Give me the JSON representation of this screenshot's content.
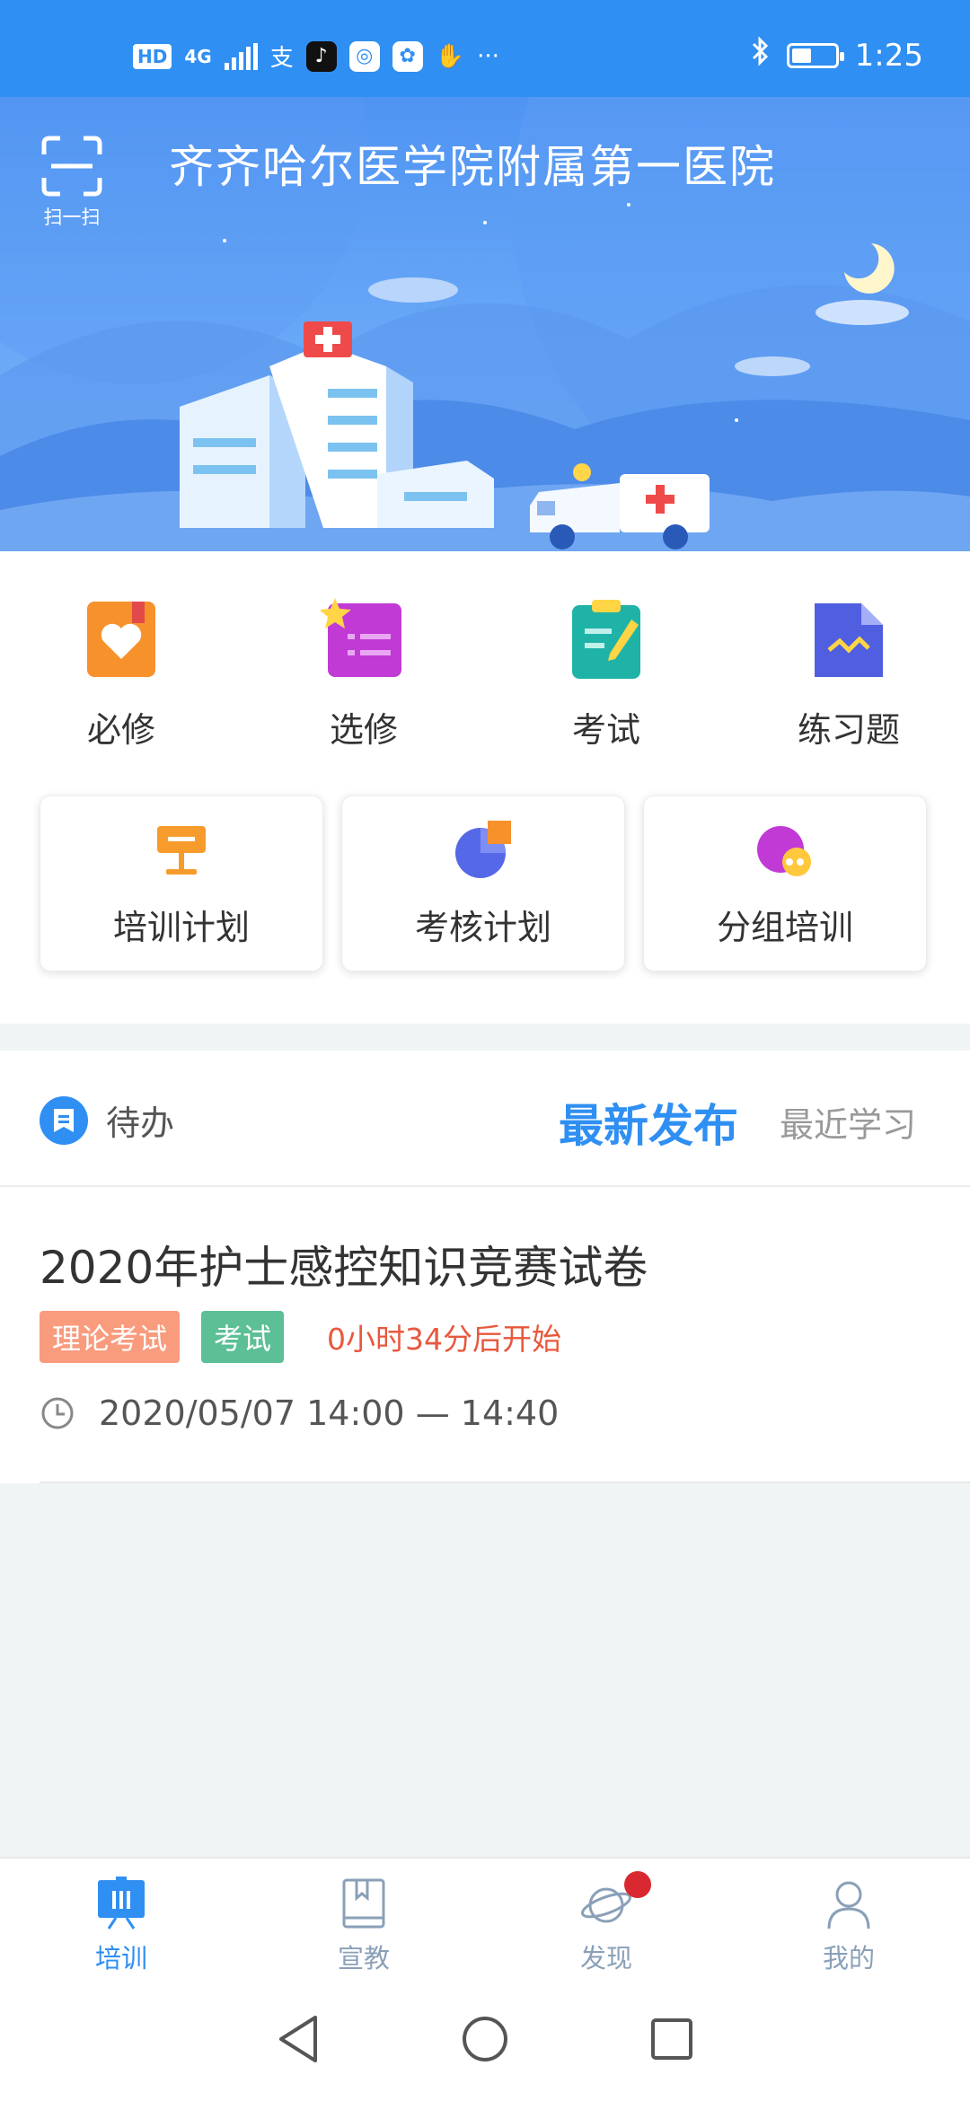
{
  "status_bar": {
    "network_badge": "HD",
    "network_type": "4G",
    "app_glyphs": [
      "支",
      "♪"
    ],
    "more": "···",
    "time": "1:25",
    "battery_level": 0.45
  },
  "header": {
    "scan_label": "扫一扫",
    "hospital_name": "齐齐哈尔医学院附属第一医院"
  },
  "quick_menu": [
    {
      "label": "必修",
      "icon": "heart-book-icon"
    },
    {
      "label": "选修",
      "icon": "star-list-icon"
    },
    {
      "label": "考试",
      "icon": "clipboard-pen-icon"
    },
    {
      "label": "练习题",
      "icon": "document-wave-icon"
    }
  ],
  "plan_cards": [
    {
      "label": "培训计划",
      "icon": "presentation-board-icon"
    },
    {
      "label": "考核计划",
      "icon": "pie-chart-icon"
    },
    {
      "label": "分组培训",
      "icon": "group-chat-icon"
    }
  ],
  "tabs": {
    "todo_label": "待办",
    "latest_label": "最新发布",
    "recent_label": "最近学习"
  },
  "list_items": [
    {
      "title": "2020年护士感控知识竞赛试卷",
      "tag_type": "理论考试",
      "tag_category": "考试",
      "countdown": "0小时34分后开始",
      "time_range": "2020/05/07 14:00 — 14:40"
    }
  ],
  "bottom_nav": [
    {
      "label": "培训",
      "icon": "training-board-icon",
      "active": true
    },
    {
      "label": "宣教",
      "icon": "book-icon",
      "active": false
    },
    {
      "label": "发现",
      "icon": "planet-icon",
      "active": false,
      "badge": true
    },
    {
      "label": "我的",
      "icon": "person-icon",
      "active": false
    }
  ],
  "colors": {
    "accent": "#2f8ff2",
    "countdown_red": "#e8583d",
    "tag_orange": "#f99b7d",
    "tag_green": "#5cbf95"
  }
}
